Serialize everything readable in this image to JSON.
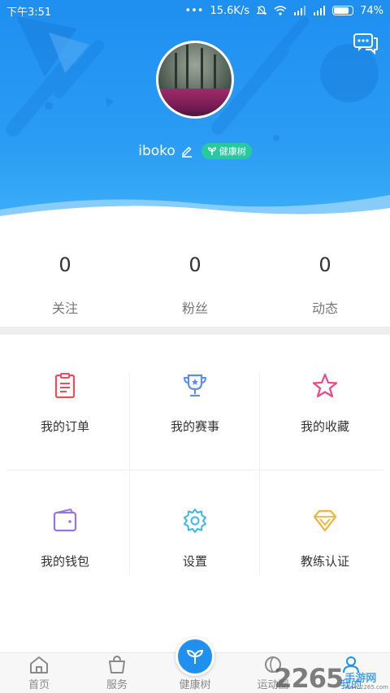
{
  "status_bar": {
    "time": "下午3:51",
    "dots": "•••",
    "speed": "15.6K/s",
    "battery": "74%"
  },
  "profile": {
    "username": "iboko",
    "tag": "健康树"
  },
  "stats": [
    {
      "value": "0",
      "label": "关注"
    },
    {
      "value": "0",
      "label": "粉丝"
    },
    {
      "value": "0",
      "label": "动态"
    }
  ],
  "menu": [
    {
      "label": "我的订单",
      "icon": "order-icon"
    },
    {
      "label": "我的赛事",
      "icon": "trophy-icon"
    },
    {
      "label": "我的收藏",
      "icon": "star-icon"
    },
    {
      "label": "我的钱包",
      "icon": "wallet-icon"
    },
    {
      "label": "设置",
      "icon": "gear-icon"
    },
    {
      "label": "教练认证",
      "icon": "diamond-icon"
    }
  ],
  "bottom_nav": [
    {
      "label": "首页",
      "icon": "home-icon"
    },
    {
      "label": "服务",
      "icon": "bag-icon"
    },
    {
      "label": "健康树",
      "icon": "sprout-icon"
    },
    {
      "label": "运动圈",
      "icon": "circle-icon"
    },
    {
      "label": "我的",
      "icon": "user-icon",
      "active": true
    }
  ],
  "watermark": {
    "number": "2265",
    "site": "手游网",
    "url": "www.2265.com"
  },
  "colors": {
    "primary": "#1f8ff0",
    "tag": "#29c9a0",
    "order": "#e8505b",
    "trophy": "#5b8ef0",
    "star": "#f0478a",
    "wallet": "#9a72e8",
    "gear": "#3fb6f0",
    "diamond": "#f0b23a"
  }
}
